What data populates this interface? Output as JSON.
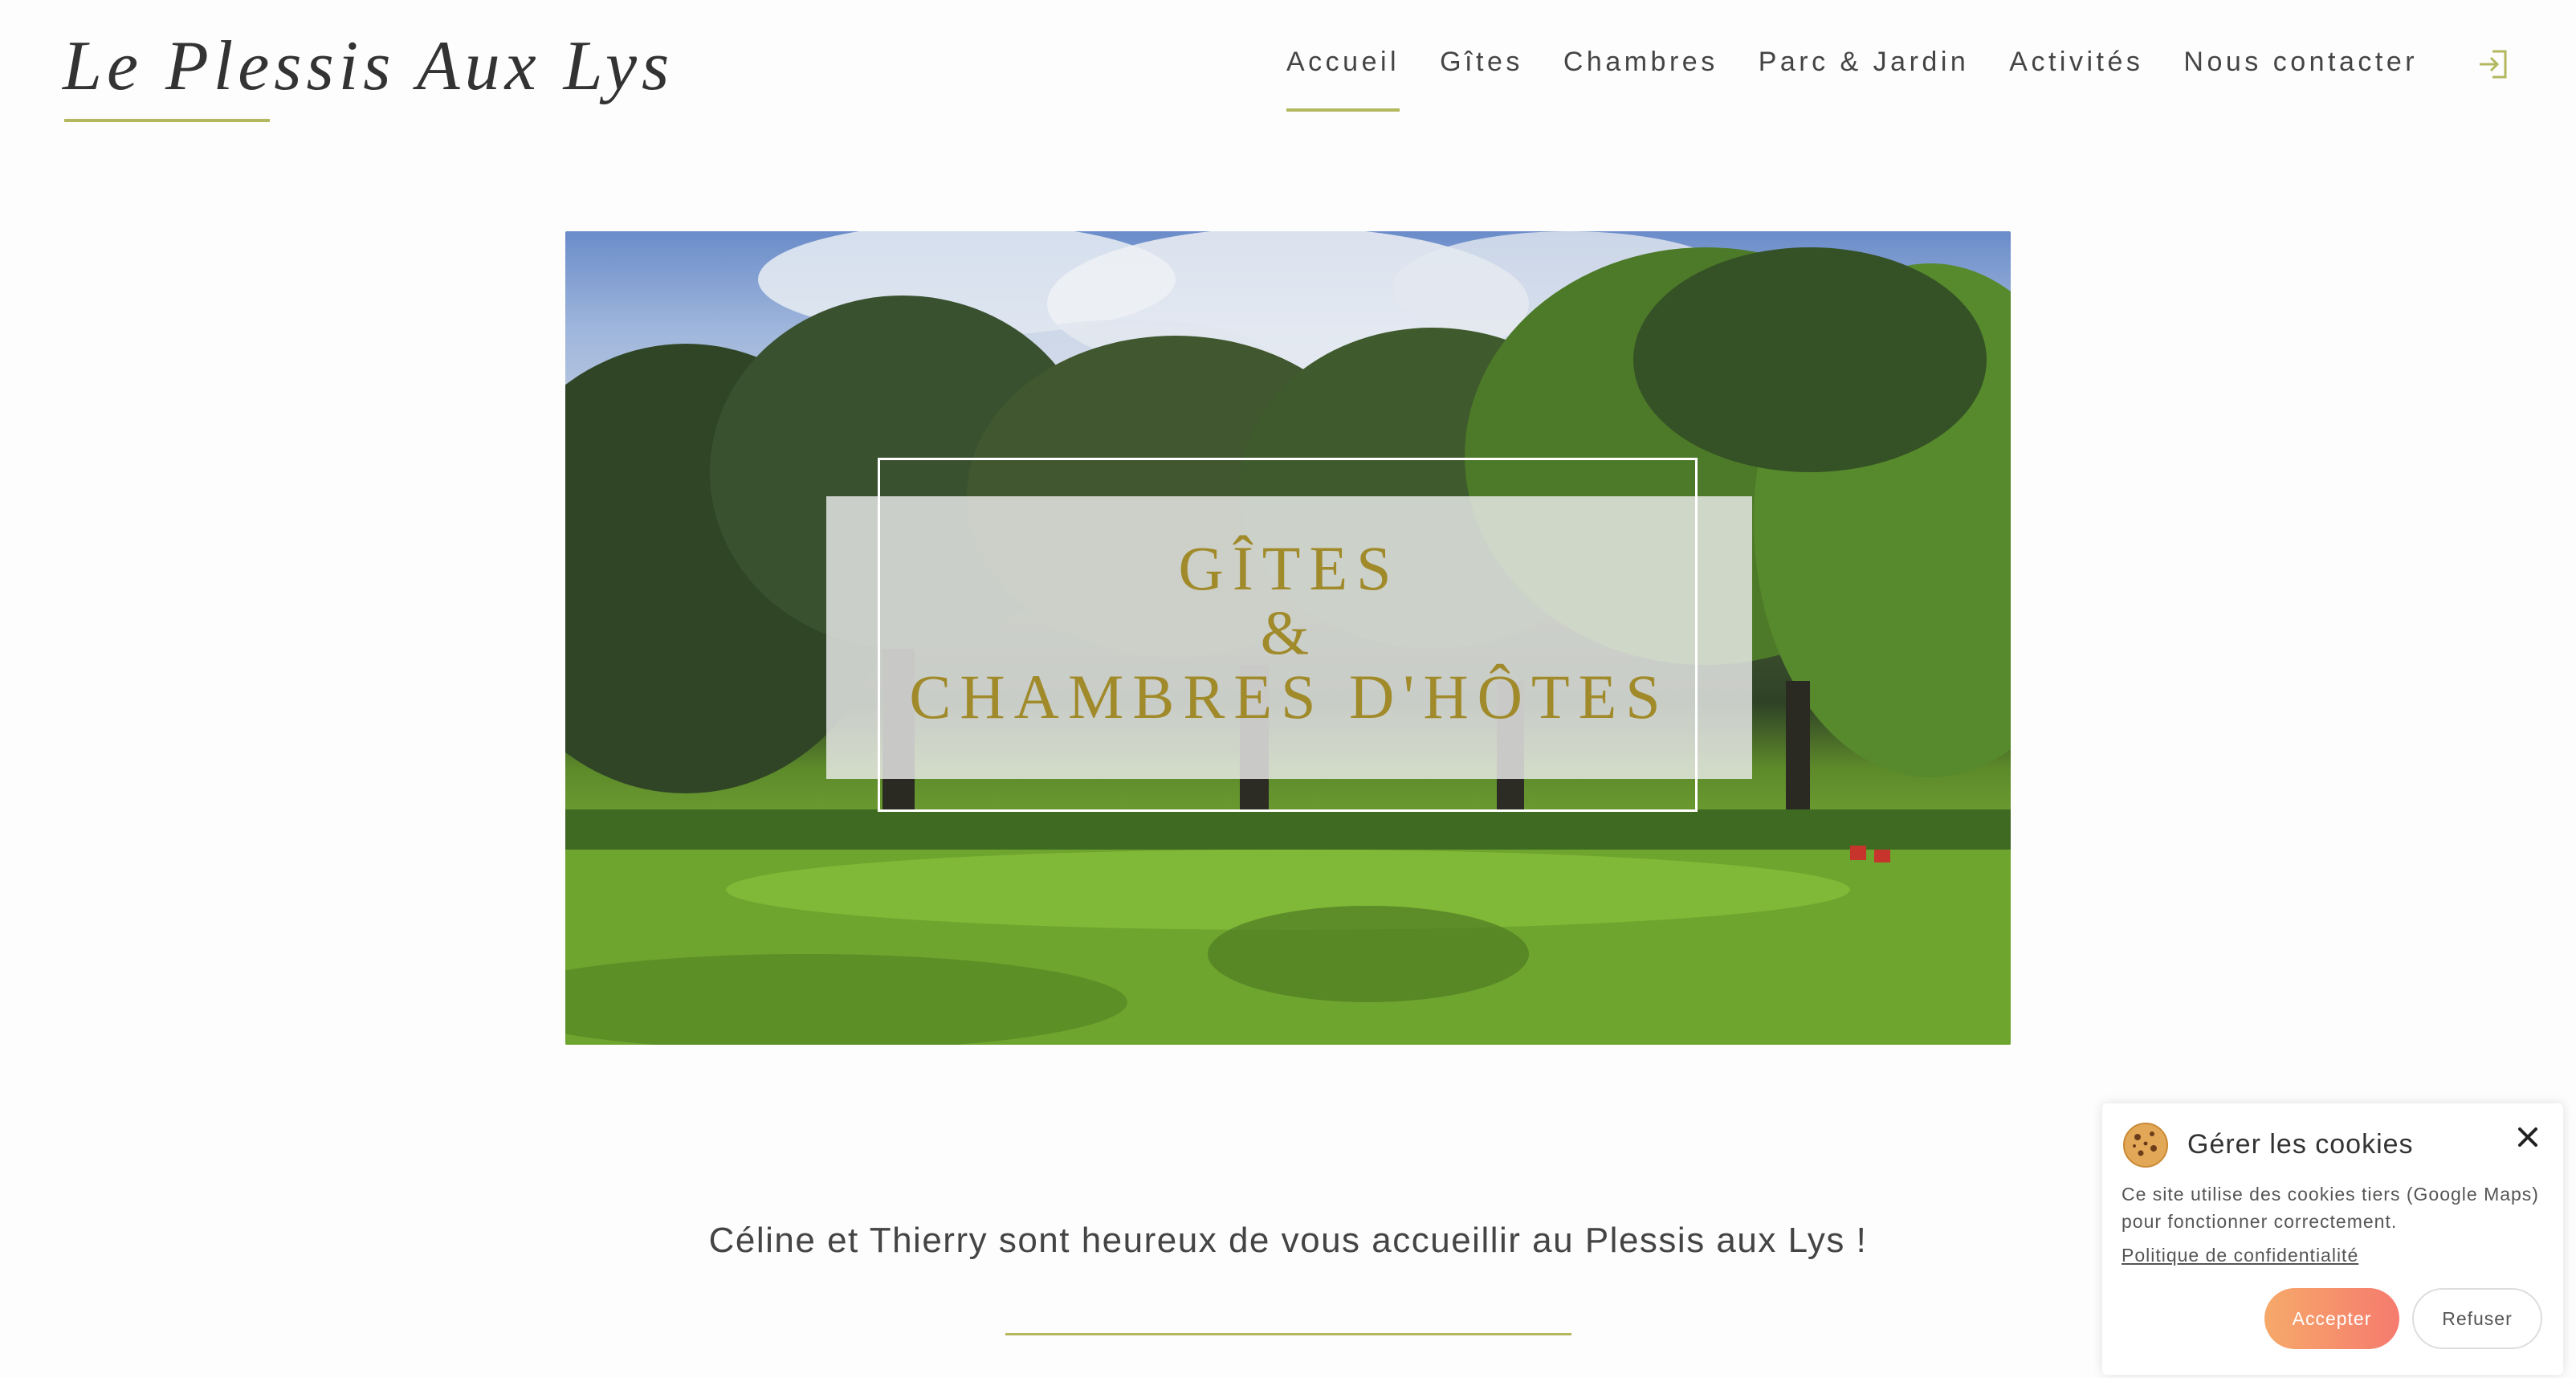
{
  "site": {
    "logo_text": "Le Plessis Aux Lys"
  },
  "nav": {
    "items": [
      {
        "label": "Accueil",
        "active": true
      },
      {
        "label": "Gîtes",
        "active": false
      },
      {
        "label": "Chambres",
        "active": false
      },
      {
        "label": "Parc & Jardin",
        "active": false
      },
      {
        "label": "Activités",
        "active": false
      },
      {
        "label": "Nous contacter",
        "active": false
      }
    ],
    "login_icon": "login-icon"
  },
  "hero": {
    "line1": "GÎTES",
    "line2": "&",
    "line3": "CHAMBRES D'HÔTES"
  },
  "welcome": {
    "text": "Céline et Thierry sont heureux de vous accueillir au Plessis aux Lys !"
  },
  "cookie": {
    "icon": "cookie-icon",
    "title": "Gérer les cookies",
    "text": "Ce site utilise des cookies tiers (Google Maps) pour fonctionner correctement.",
    "policy_link": "Politique de confidentialité",
    "accept_label": "Accepter",
    "refuse_label": "Refuser"
  },
  "colors": {
    "accent": "#b3b85e",
    "hero_text": "#a08a2a",
    "accept_gradient_start": "#f6a96a",
    "accept_gradient_end": "#f57b6e"
  }
}
